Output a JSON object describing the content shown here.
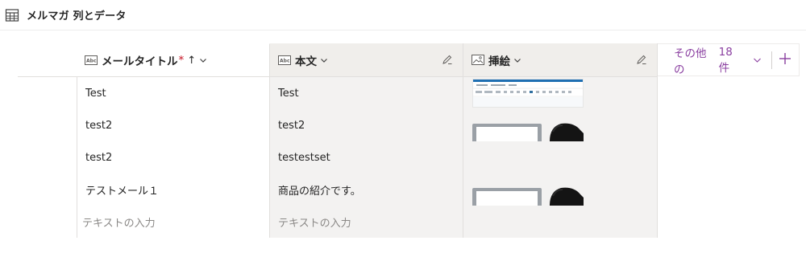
{
  "header": {
    "title": "メルマガ 列とデータ"
  },
  "columns": [
    {
      "label": "メールタイトル",
      "required_mark": "*",
      "sort_mark": "↑",
      "type_icon": "text-field-icon"
    },
    {
      "label": "本文",
      "type_icon": "text-field-icon"
    },
    {
      "label": "挿絵",
      "type_icon": "image-field-icon"
    }
  ],
  "more_columns": {
    "label": "その他の",
    "count": "18 件",
    "add_icon": "plus-icon"
  },
  "rows": [
    {
      "title": "Test",
      "body": "Test",
      "image": "screenshot-thumbnail"
    },
    {
      "title": "test2",
      "body": "test2",
      "image": "monitor-person-thumbnail"
    },
    {
      "title": "test2",
      "body": "testestset",
      "image": ""
    },
    {
      "title": "テストメール１",
      "body": "商品の紹介です。",
      "image": "monitor-person-thumbnail"
    }
  ],
  "new_row": {
    "title_placeholder": "テキストの入力",
    "body_placeholder": "テキストの入力"
  },
  "colors": {
    "accent": "#8a3fa0",
    "required": "#c50f1f",
    "readonly_bg": "#f3f2f1"
  }
}
